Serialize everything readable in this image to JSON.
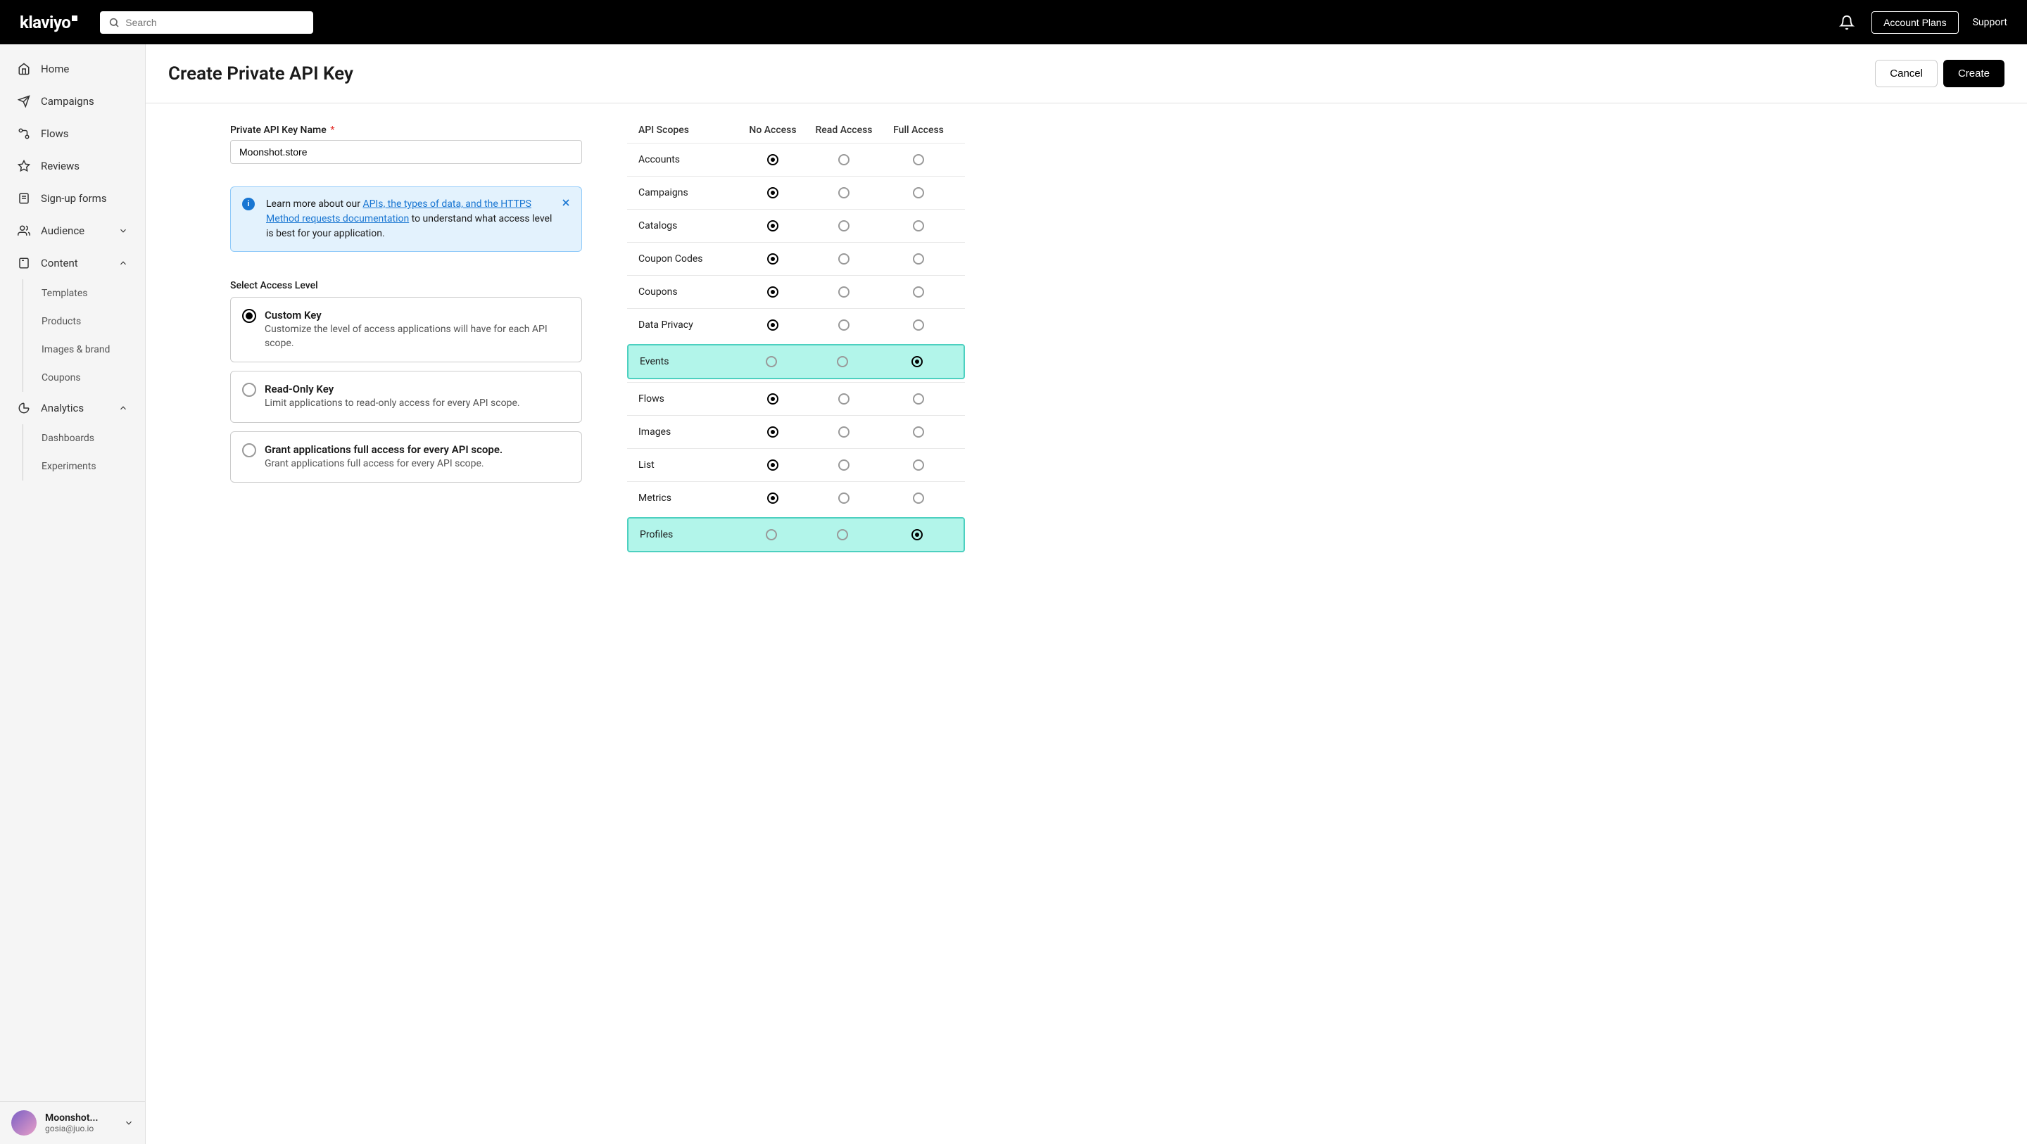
{
  "header": {
    "logo_text": "klaviyo",
    "search_placeholder": "Search",
    "account_plans": "Account Plans",
    "support": "Support"
  },
  "sidebar": {
    "items": [
      {
        "label": "Home",
        "icon": "home"
      },
      {
        "label": "Campaigns",
        "icon": "send"
      },
      {
        "label": "Flows",
        "icon": "flow"
      },
      {
        "label": "Reviews",
        "icon": "star"
      },
      {
        "label": "Sign-up forms",
        "icon": "form"
      },
      {
        "label": "Audience",
        "icon": "people",
        "expandable": true,
        "expanded": false
      },
      {
        "label": "Content",
        "icon": "content",
        "expandable": true,
        "expanded": true,
        "children": [
          {
            "label": "Templates"
          },
          {
            "label": "Products"
          },
          {
            "label": "Images & brand"
          },
          {
            "label": "Coupons"
          }
        ]
      },
      {
        "label": "Analytics",
        "icon": "chart",
        "expandable": true,
        "expanded": true,
        "children": [
          {
            "label": "Dashboards"
          },
          {
            "label": "Experiments"
          }
        ]
      }
    ],
    "footer": {
      "name": "Moonshot...",
      "email": "gosia@juo.io"
    }
  },
  "page": {
    "title": "Create Private API Key",
    "cancel": "Cancel",
    "create": "Create"
  },
  "form": {
    "name_label": "Private API Key Name",
    "name_value": "Moonshot.store",
    "info_prefix": "Learn more about our ",
    "info_link": "APIs, the types of data, and the HTTPS Method requests documentation",
    "info_suffix": " to understand what access level is best for your application.",
    "access_label": "Select Access Level",
    "options": [
      {
        "title": "Custom Key",
        "desc": "Customize the level of access applications will have for each API scope.",
        "selected": true
      },
      {
        "title": "Read-Only Key",
        "desc": "Limit applications to read-only access for every API scope.",
        "selected": false
      },
      {
        "title": "Grant applications full access for every API scope.",
        "desc": "Grant applications full access for every API scope.",
        "selected": false
      }
    ]
  },
  "scopes": {
    "headers": [
      "API Scopes",
      "No Access",
      "Read Access",
      "Full Access"
    ],
    "rows": [
      {
        "name": "Accounts",
        "selected": "no",
        "highlighted": false
      },
      {
        "name": "Campaigns",
        "selected": "no",
        "highlighted": false
      },
      {
        "name": "Catalogs",
        "selected": "no",
        "highlighted": false
      },
      {
        "name": "Coupon Codes",
        "selected": "no",
        "highlighted": false
      },
      {
        "name": "Coupons",
        "selected": "no",
        "highlighted": false
      },
      {
        "name": "Data Privacy",
        "selected": "no",
        "highlighted": false
      },
      {
        "name": "Events",
        "selected": "full",
        "highlighted": true
      },
      {
        "name": "Flows",
        "selected": "no",
        "highlighted": false
      },
      {
        "name": "Images",
        "selected": "no",
        "highlighted": false
      },
      {
        "name": "List",
        "selected": "no",
        "highlighted": false
      },
      {
        "name": "Metrics",
        "selected": "no",
        "highlighted": false
      },
      {
        "name": "Profiles",
        "selected": "full",
        "highlighted": true
      }
    ]
  }
}
